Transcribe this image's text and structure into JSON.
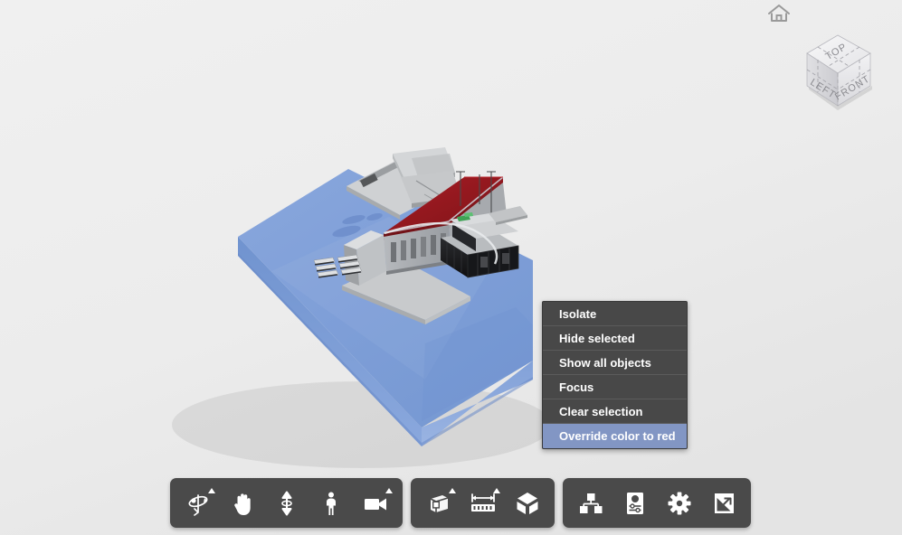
{
  "app": {
    "title": "3D Model Viewer",
    "background_color": "#ececec"
  },
  "viewport": {
    "name": "3d-viewport",
    "terrain_color": "#7f9fd8",
    "terrain_side_color": "#6f90ce",
    "highlight_color": "#9e1b22",
    "building_color": "#c9cbcd",
    "dark_building_color": "#1b1b1d",
    "description": "Isometric BIM site model with blue terrain slab, gray building and red override-colored roof"
  },
  "home_button": {
    "icon": "home-icon",
    "label": "Home view"
  },
  "viewcube": {
    "name": "view-cube",
    "faces": {
      "top": "TOP",
      "left": "LEFT",
      "front": "FRONT"
    },
    "top_color": "#efefef",
    "left_color": "#d8d8da",
    "front_color": "#e8e8ea",
    "edge_color": "#9a9aa0"
  },
  "context_menu": {
    "name": "context-menu",
    "background": "#484848",
    "highlight_color": "#8296c4",
    "items": [
      {
        "label": "Isolate",
        "highlighted": false
      },
      {
        "label": "Hide selected",
        "highlighted": false
      },
      {
        "label": "Show all objects",
        "highlighted": false
      },
      {
        "label": "Focus",
        "highlighted": false
      },
      {
        "label": "Clear selection",
        "highlighted": false
      },
      {
        "label": "Override color to red",
        "highlighted": true
      }
    ]
  },
  "toolbars": {
    "background": "#4a4a4a",
    "groups": [
      {
        "name": "navigation-tools",
        "buttons": [
          {
            "icon": "orbit-icon",
            "label": "Orbit",
            "has_dropdown": true
          },
          {
            "icon": "pan-hand-icon",
            "label": "Pan",
            "has_dropdown": false
          },
          {
            "icon": "zoom-arrows-icon",
            "label": "Zoom",
            "has_dropdown": false
          },
          {
            "icon": "walk-person-icon",
            "label": "Walk",
            "has_dropdown": false
          },
          {
            "icon": "camera-icon",
            "label": "Camera",
            "has_dropdown": true
          }
        ]
      },
      {
        "name": "model-tools",
        "buttons": [
          {
            "icon": "section-box-icon",
            "label": "Section",
            "has_dropdown": true
          },
          {
            "icon": "measure-ruler-icon",
            "label": "Measure",
            "has_dropdown": true
          },
          {
            "icon": "explode-cube-icon",
            "label": "Explode",
            "has_dropdown": false
          }
        ]
      },
      {
        "name": "panel-tools",
        "buttons": [
          {
            "icon": "model-tree-icon",
            "label": "Model tree",
            "has_dropdown": false
          },
          {
            "icon": "properties-panel-icon",
            "label": "Properties",
            "has_dropdown": false
          },
          {
            "icon": "settings-gear-icon",
            "label": "Settings",
            "has_dropdown": false
          },
          {
            "icon": "fullscreen-icon",
            "label": "Fullscreen",
            "has_dropdown": false
          }
        ]
      }
    ]
  }
}
